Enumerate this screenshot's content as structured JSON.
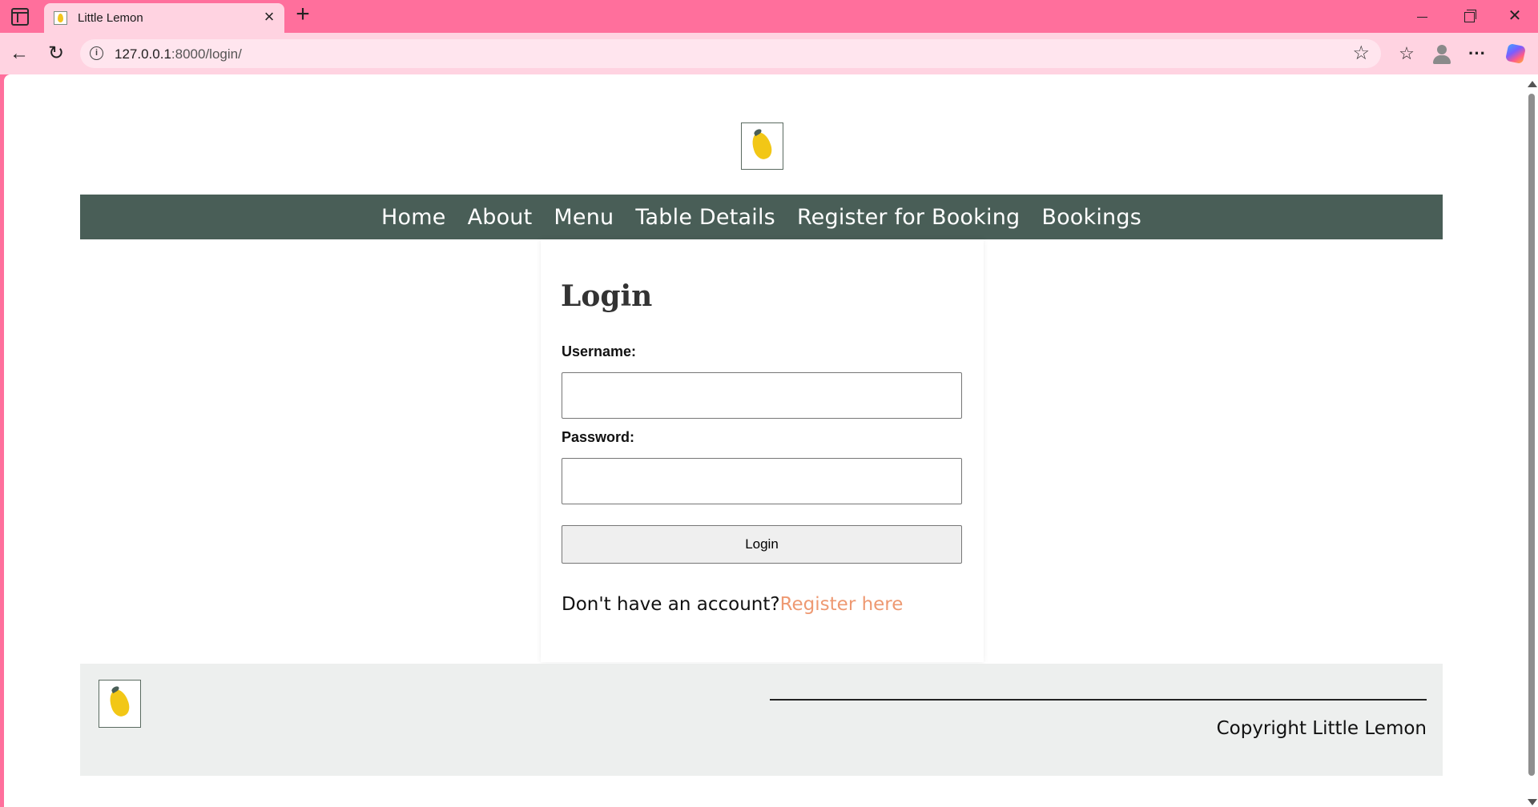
{
  "browser": {
    "tab_title": "Little Lemon",
    "url_host": "127.0.0.1",
    "url_rest": ":8000/login/"
  },
  "nav": {
    "items": [
      "Home",
      "About",
      "Menu",
      "Table Details",
      "Register for Booking",
      "Bookings"
    ]
  },
  "login": {
    "title": "Login",
    "username_label": "Username:",
    "username_value": "",
    "password_label": "Password:",
    "password_value": "",
    "button_label": "Login",
    "register_prompt": "Don't have an account?",
    "register_link": "Register here"
  },
  "footer": {
    "copyright": "Copyright Little Lemon"
  },
  "colors": {
    "browser_frame": "#ff6f9c",
    "nav_bg": "#495e57",
    "link_accent": "#ee9972",
    "footer_bg": "#edefee",
    "lemon": "#f2c716"
  },
  "icons": {
    "tab_favicon": "lemon-favicon-icon",
    "logo": "lemon-logo-icon"
  }
}
